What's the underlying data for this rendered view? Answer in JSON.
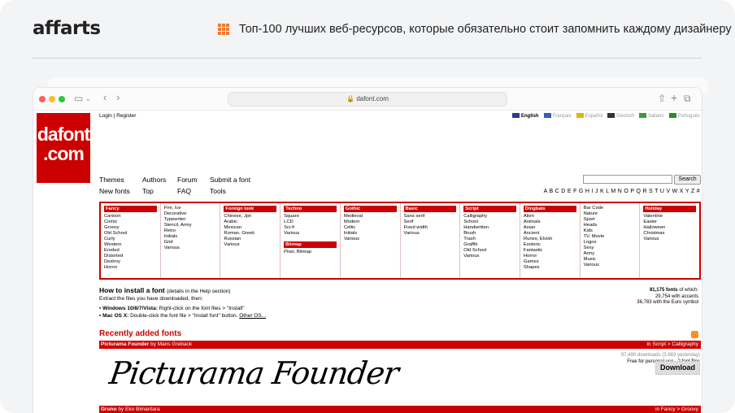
{
  "brand": {
    "logo": "affarts",
    "title": "Топ-100 лучших веб-ресурсов, которые обязательно стоит запомнить каждому дизайнеру"
  },
  "browser": {
    "url": "dafont.com",
    "icons": {
      "sidebar": "sidebar-icon",
      "share": "share-icon",
      "new_tab": "plus-icon",
      "tabs": "tabs-icon"
    }
  },
  "site": {
    "logo_line1": "dafont",
    "logo_line2": ".com",
    "login": "Login",
    "sep": "|",
    "register": "Register",
    "languages": [
      "English",
      "Français",
      "Español",
      "Deutsch",
      "Italiano",
      "Português"
    ],
    "nav": [
      "Themes",
      "Authors",
      "Forum",
      "Submit a font",
      "New fonts",
      "Top",
      "FAQ",
      "Tools"
    ],
    "search_button": "Search",
    "alphabet": "A B C D E F G H I J K L M N O P Q R S T U V W X Y Z #"
  },
  "categories": [
    {
      "head": "Fancy",
      "items": [
        "Cartoon",
        "Comic",
        "Groovy",
        "Old School",
        "Curly",
        "Western",
        "Eroded",
        "Distorted",
        "Destroy",
        "Horror"
      ]
    },
    {
      "head": "",
      "items": [
        "Fire, Ice",
        "Decorative",
        "Typewriter",
        "Stencil, Army",
        "Retro",
        "Initials",
        "Grid",
        "Various"
      ]
    },
    {
      "head": "Foreign look",
      "items": [
        "Chinese, Jpn",
        "Arabic",
        "Mexican",
        "Roman, Greek",
        "Russian",
        "Various"
      ]
    },
    {
      "head": "Techno",
      "items": [
        "Square",
        "LCD",
        "Sci-fi",
        "Various"
      ],
      "head2": "Bitmap",
      "items2": [
        "Pixel, Bitmap"
      ]
    },
    {
      "head": "Gothic",
      "items": [
        "Medieval",
        "Modern",
        "Celtic",
        "Initials",
        "Various"
      ]
    },
    {
      "head": "Basic",
      "items": [
        "Sans serif",
        "Serif",
        "Fixed width",
        "Various"
      ]
    },
    {
      "head": "Script",
      "items": [
        "Calligraphy",
        "School",
        "Handwritten",
        "Brush",
        "Trash",
        "Graffiti",
        "Old School",
        "Various"
      ]
    },
    {
      "head": "Dingbats",
      "items": [
        "Alien",
        "Animals",
        "Asian",
        "Ancient",
        "Runes, Elvish",
        "Esoteric",
        "Fantastic",
        "Horror",
        "Games",
        "Shapes"
      ]
    },
    {
      "head": "",
      "items": [
        "Bar Code",
        "Nature",
        "Sport",
        "Heads",
        "Kids",
        "TV, Movie",
        "Logos",
        "Sexy",
        "Army",
        "Music",
        "Various"
      ]
    },
    {
      "head": "Holiday",
      "items": [
        "Valentine",
        "Easter",
        "Halloween",
        "Christmas",
        "Various"
      ]
    }
  ],
  "install": {
    "title": "How to install a font",
    "details": "(details in the Help section)",
    "sub": "Extract the files you have downloaded, then:",
    "win": "Windows 10/8/7/Vista:",
    "win_text": "Right-click on the font files > \"Install\"",
    "mac": "Mac OS X:",
    "mac_text": "Double-click the font file > \"Install font\" button.",
    "other": "Other OS..."
  },
  "counts": {
    "total": "81,175 fonts",
    "total_suffix": "of which:",
    "accents": "29,754 with accents",
    "euro": "36,783 with the Euro symbol"
  },
  "recent": {
    "title": "Recently added fonts",
    "font1": {
      "name": "Picturama Founder",
      "by": "by Mans Greback",
      "category": "in Script > Calligraphy",
      "downloads": "97,490 downloads (3,983 yesterday)",
      "license": "Free for personal use - 2 font files",
      "preview": "Picturama Founder",
      "download": "Download"
    },
    "font2": {
      "name": "Gruno",
      "by": "by Eko Bimantara",
      "category": "in Fancy > Groovy"
    }
  }
}
